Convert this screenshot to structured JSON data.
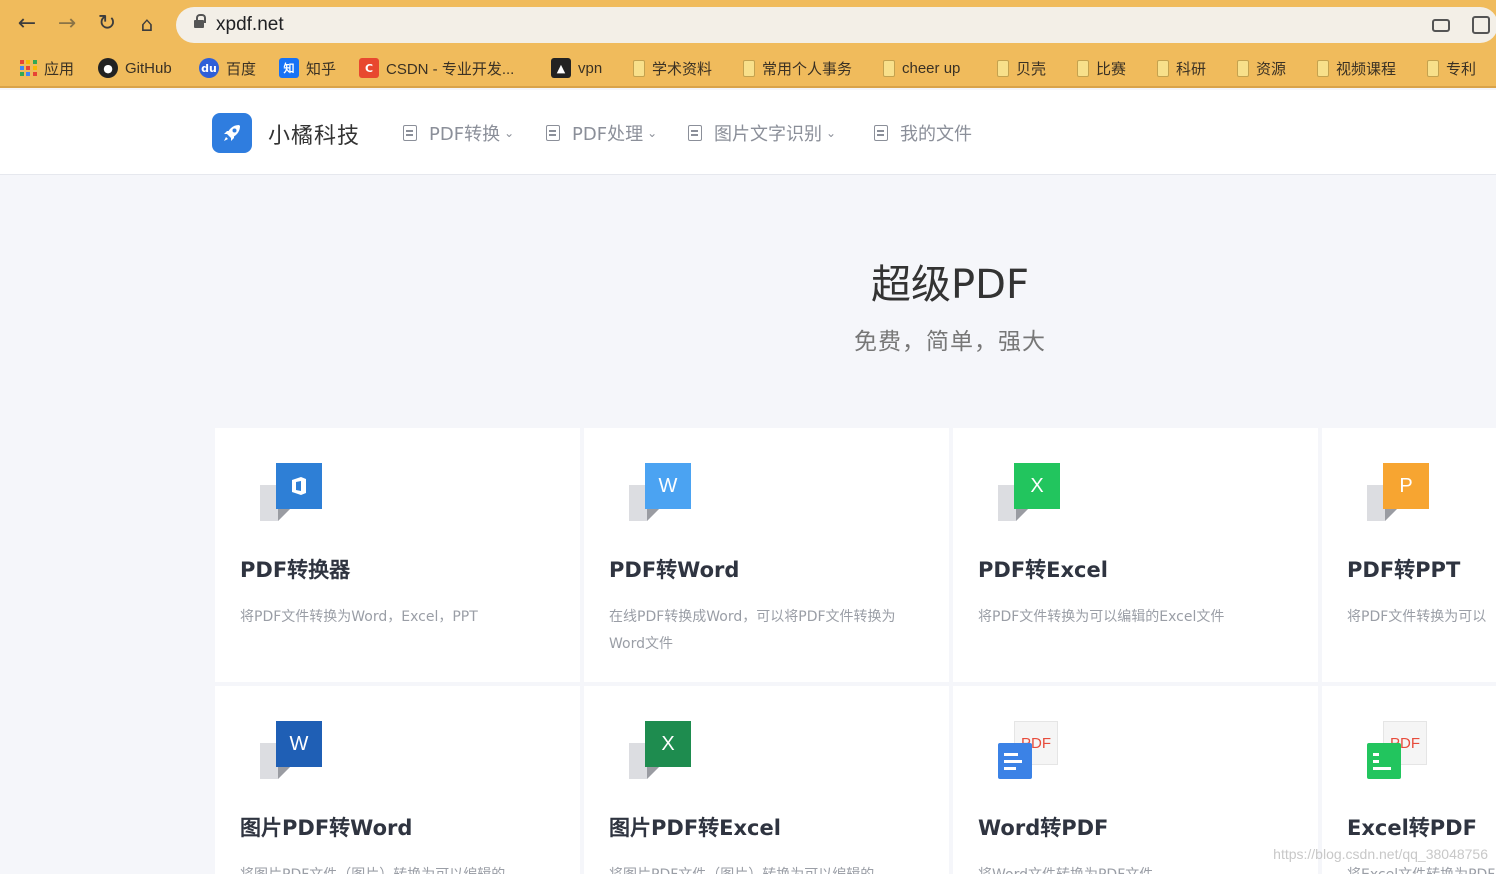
{
  "browser": {
    "url": "xpdf.net",
    "bookmarks": [
      {
        "label": "应用",
        "icon": "apps-grid-icon"
      },
      {
        "label": "GitHub",
        "icon": "github-icon"
      },
      {
        "label": "百度",
        "icon": "baidu-icon"
      },
      {
        "label": "知乎",
        "icon": "zhihu-icon",
        "glyph": "知"
      },
      {
        "label": "CSDN - 专业开发...",
        "icon": "csdn-icon",
        "glyph": "C"
      },
      {
        "label": "vpn",
        "icon": "vpn-icon"
      },
      {
        "label": "学术资料",
        "icon": "folder-icon"
      },
      {
        "label": "常用个人事务",
        "icon": "folder-icon"
      },
      {
        "label": "cheer up",
        "icon": "folder-icon"
      },
      {
        "label": "贝壳",
        "icon": "folder-icon"
      },
      {
        "label": "比赛",
        "icon": "folder-icon"
      },
      {
        "label": "科研",
        "icon": "folder-icon"
      },
      {
        "label": "资源",
        "icon": "folder-icon"
      },
      {
        "label": "视频课程",
        "icon": "folder-icon"
      },
      {
        "label": "专利",
        "icon": "folder-icon"
      }
    ]
  },
  "site": {
    "brand": "小橘科技",
    "nav": [
      {
        "label": "PDF转换",
        "dropdown": true
      },
      {
        "label": "PDF处理",
        "dropdown": true
      },
      {
        "label": "图片文字识别",
        "dropdown": true
      },
      {
        "label": "我的文件",
        "dropdown": false
      }
    ],
    "chevron": "⌄"
  },
  "hero": {
    "title": "超级PDF",
    "subtitle": "免费，简单，强大"
  },
  "cards": [
    {
      "title": "PDF转换器",
      "desc": "将PDF文件转换为Word，Excel，PPT",
      "icon": "office-icon",
      "glyph": "",
      "color": "#2e7fd6"
    },
    {
      "title": "PDF转Word",
      "desc": "在线PDF转换成Word，可以将PDF文件转换为Word文件",
      "icon": "word-icon",
      "glyph": "W",
      "color": "#4ba3f2"
    },
    {
      "title": "PDF转Excel",
      "desc": "将PDF文件转换为可以编辑的Excel文件",
      "icon": "excel-icon",
      "glyph": "X",
      "color": "#22c55e"
    },
    {
      "title": "PDF转PPT",
      "desc": "将PDF文件转换为可以",
      "icon": "ppt-icon",
      "glyph": "P",
      "color": "#f7a531"
    },
    {
      "title": "图片PDF转Word",
      "desc": "将图片PDF文件（图片）转换为可以编辑的",
      "icon": "word-icon",
      "glyph": "W",
      "color": "#1f5fb5"
    },
    {
      "title": "图片PDF转Excel",
      "desc": "将图片PDF文件（图片）转换为可以编辑的",
      "icon": "excel-icon",
      "glyph": "X",
      "color": "#1e8c4f"
    },
    {
      "title": "Word转PDF",
      "desc": "将Word文件转换为PDF文件",
      "icon": "word-to-pdf-icon",
      "glyph": "PDF",
      "color": "#3b82e6"
    },
    {
      "title": "Excel转PDF",
      "desc": "将Excel文件转换为PDF",
      "icon": "excel-to-pdf-icon",
      "glyph": "PDF",
      "color": "#22c55e"
    }
  ],
  "watermark": "https://blog.csdn.net/qq_38048756"
}
